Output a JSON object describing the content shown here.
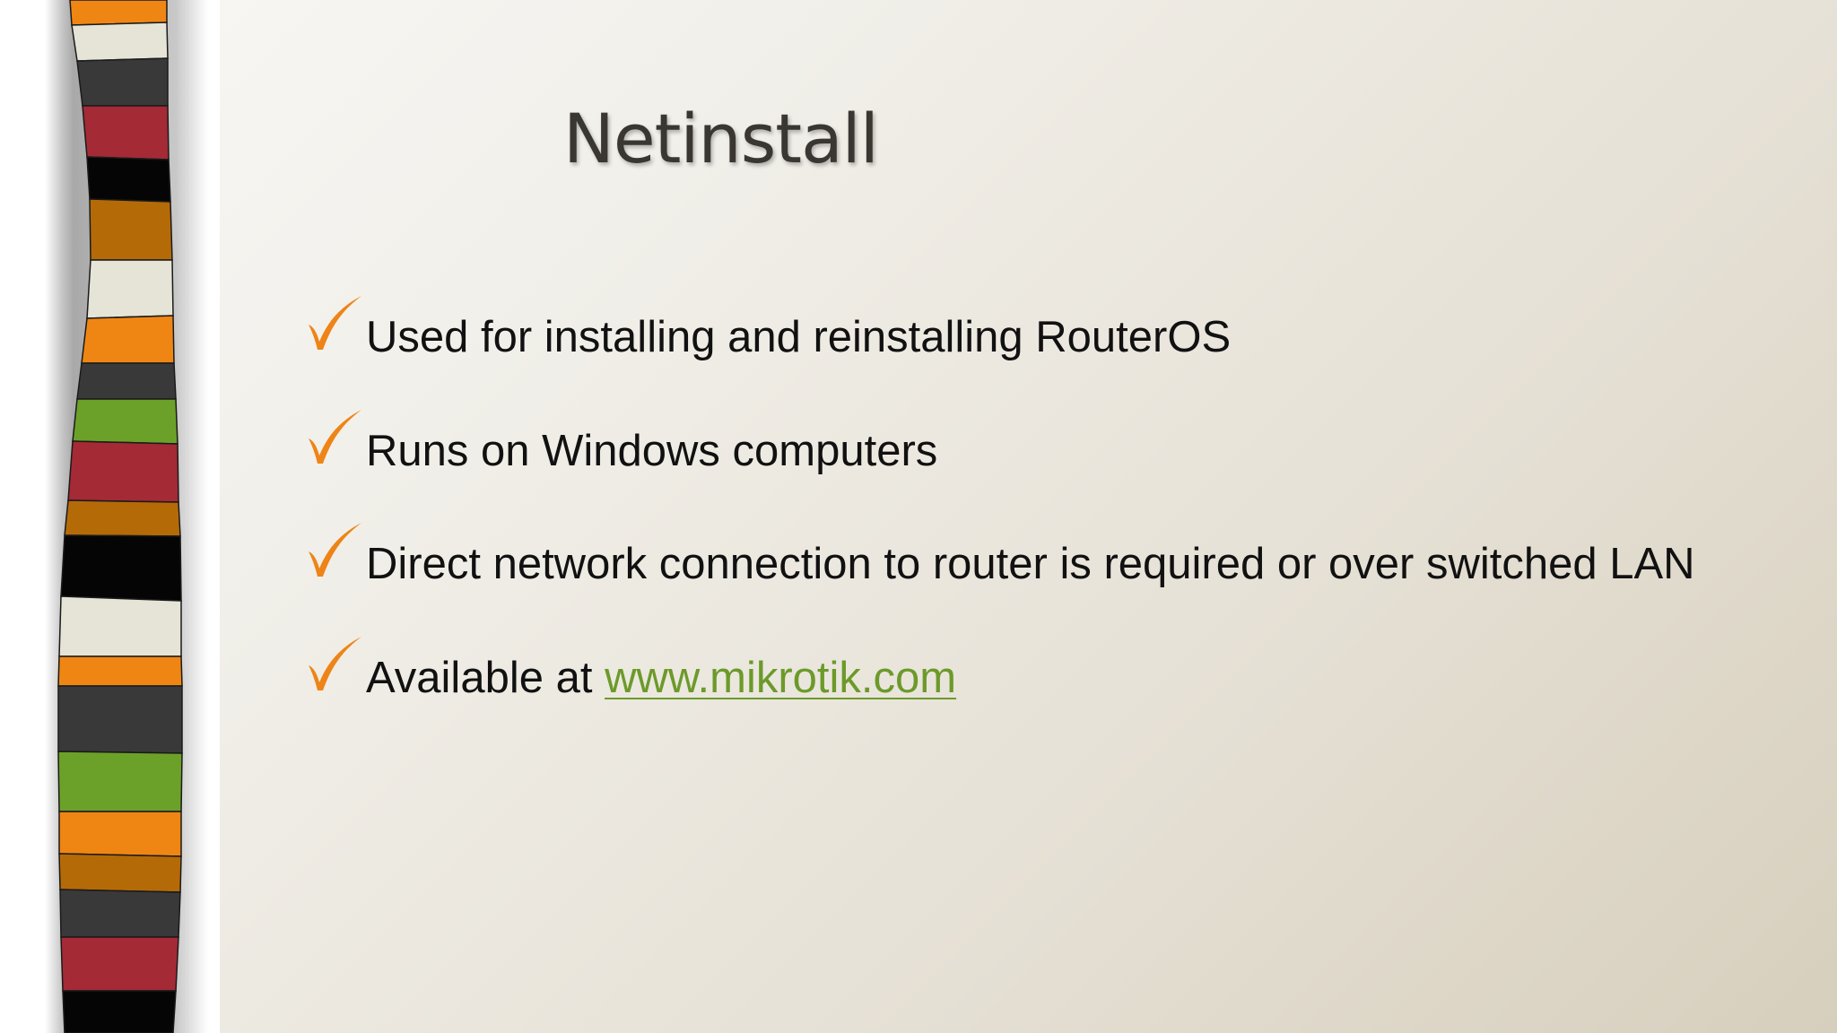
{
  "slide": {
    "title": "Netinstall",
    "bullets": [
      {
        "text": "Used for installing and reinstalling  RouterOS"
      },
      {
        "text": "Runs on Windows computers"
      },
      {
        "text": "Direct network connection to router is  required or over switched LAN"
      },
      {
        "text": "Available at ",
        "link": "www.mikrotik.com"
      }
    ],
    "bullet_icon": "checkmark-icon",
    "colors": {
      "checkmark": "#ee8417",
      "link": "#6c9a2a",
      "title": "#3a3733",
      "stripe_orange": "#ef8613",
      "stripe_cream": "#e6e4d6",
      "stripe_charcoal": "#393939",
      "stripe_red": "#a42a36",
      "stripe_black": "#050505",
      "stripe_brown": "#b56a08",
      "stripe_green": "#6ca129"
    }
  }
}
